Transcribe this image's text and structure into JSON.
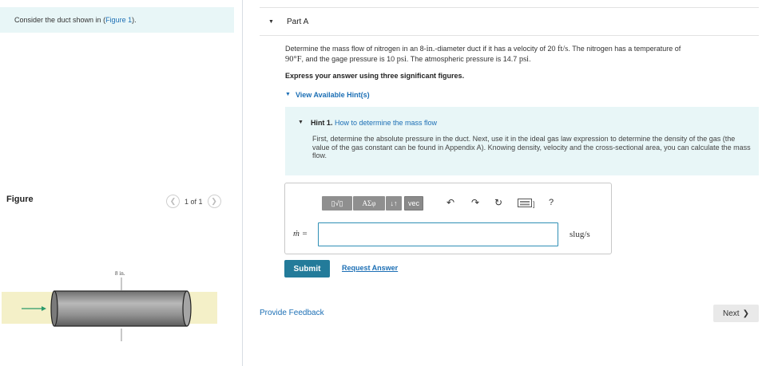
{
  "problem": {
    "intro_text": "Consider the duct shown in (",
    "figure_link": "Figure 1",
    "intro_end": ")."
  },
  "figure": {
    "label": "Figure",
    "page_indicator": "1 of 1",
    "prev_icon": "chevron-left-icon",
    "next_icon": "chevron-right-icon",
    "dimension_label": "8 in."
  },
  "part": {
    "title": "Part A",
    "question": {
      "t1": "Determine the mass flow of nitrogen in an 8-",
      "u1": "in.",
      "t2": "-diameter duct if it has a velocity of 20 ",
      "u2": "ft/s",
      "t3": ". The nitrogen has a temperature of",
      "u3": "90°F",
      "t4": ", and the gage pressure is 10 ",
      "u4": "psi",
      "t5": ". The atmospheric pressure is 14.7 ",
      "u5": "psi",
      "t6": "."
    },
    "instruction": "Express your answer using three significant figures.",
    "hints_toggle": "View Available Hint(s)"
  },
  "hint": {
    "number": "Hint 1.",
    "title": "How to determine the mass flow",
    "text": "First, determine the absolute pressure in the duct. Next, use it in the ideal gas law expression to determine the density of the gas (the value of the gas constant can be found in Appendix A). Knowing density, velocity and the cross-sectional area, you can calculate the mass flow."
  },
  "answer": {
    "toolbar": {
      "templates_label": "▯√▯",
      "greek_label": "ΑΣφ",
      "arrows_label": "↓↑",
      "vec_label": "vec",
      "undo_icon": "undo-icon",
      "redo_icon": "redo-icon",
      "reset_icon": "reset-icon",
      "keyboard_icon": "keyboard-icon",
      "help_label": "?"
    },
    "variable_label": "ṁ =",
    "input_value": "",
    "unit": "slug/s"
  },
  "actions": {
    "submit_label": "Submit",
    "request_label": "Request Answer",
    "feedback_label": "Provide Feedback",
    "next_label": "Next",
    "next_icon": "chevron-right-icon"
  },
  "colors": {
    "accent_blue": "#1c6fb5",
    "submit_bg": "#237b9a",
    "hint_bg": "#e8f6f7",
    "toolbar_gray": "#8f8f8f",
    "arrow_green": "#2a9a6a",
    "duct_gray": "#8a8a8a",
    "flow_yellow": "#f4f0c8"
  }
}
